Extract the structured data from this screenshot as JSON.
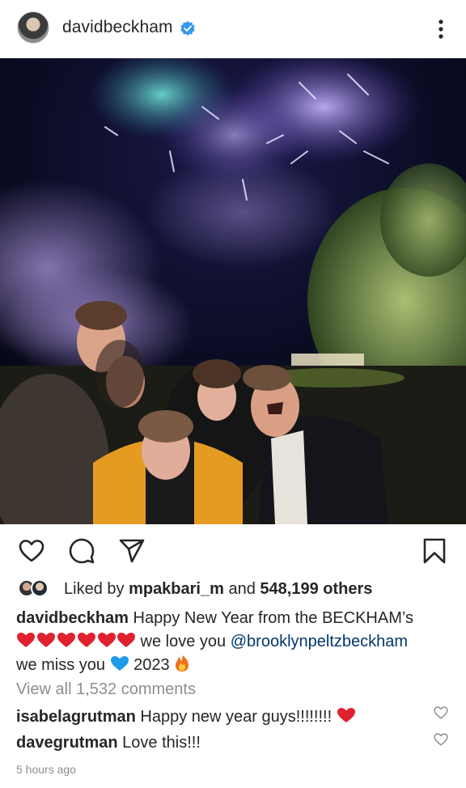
{
  "post": {
    "username": "davidbeckham",
    "verified": true,
    "icons": {
      "avatar": "profile-avatar",
      "verified": "verified-badge-icon",
      "more": "more-options-icon",
      "like": "heart-outline-icon",
      "comment": "comment-icon",
      "share": "send-icon",
      "save": "bookmark-icon"
    },
    "colors": {
      "verified": "#3897f0",
      "heart": "#ed4956",
      "mention": "#00376b",
      "muted": "#8e8e8e"
    }
  },
  "likes": {
    "prefix": "Liked by ",
    "user": "mpakbari_m",
    "middle": " and ",
    "count": "548,199 others"
  },
  "caption": {
    "username": "davidbeckham",
    "line1": " Happy New Year from the BECKHAM’s",
    "line2_text": " we love you ",
    "mention": "@brooklynpeltzbeckham",
    "line3_start": "we miss you ",
    "year": " 2023 ",
    "emoji_red_hearts": "❤️❤️❤️❤️❤️❤️",
    "emoji_blue_heart": "💙",
    "emoji_fire": "🔥"
  },
  "view_comments": "View all 1,532 comments",
  "comments": [
    {
      "user": "isabelagrutman",
      "text": " Happy new year guys!!!!!!!! "
    },
    {
      "user": "davegrutman",
      "text": " Love this!!!"
    }
  ],
  "timestamp": "5 hours ago"
}
